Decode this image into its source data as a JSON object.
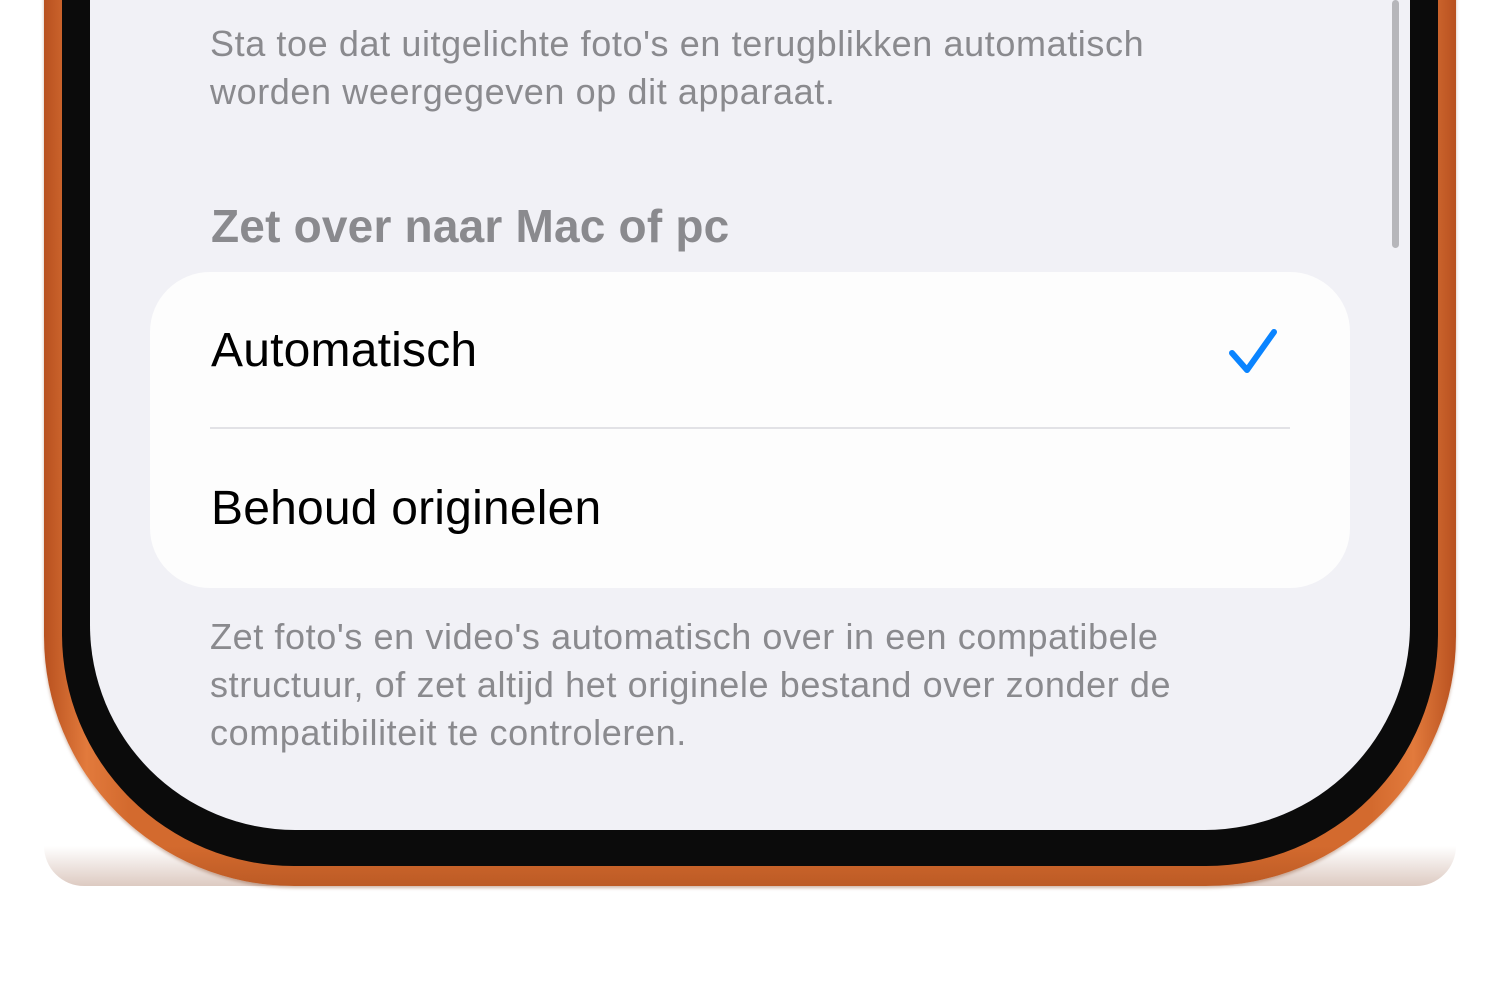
{
  "settings": {
    "top_footer": {
      "line1": "Sta toe dat uitgelichte foto's en terugblikken automatisch",
      "line2": "worden weergegeven op dit apparaat."
    },
    "section_header": "Zet over naar Mac of pc",
    "options": [
      {
        "label": "Automatisch",
        "selected": true
      },
      {
        "label": "Behoud originelen",
        "selected": false
      }
    ],
    "bottom_footer": {
      "line1": "Zet foto's en video's automatisch over in een compatibele",
      "line2": "structuur, of zet altijd het originele bestand over zonder de",
      "line3": "compatibiliteit te controleren."
    }
  },
  "icons": {
    "selected_indicator": "checkmark-icon"
  },
  "colors": {
    "accent": "#0a84ff",
    "frame": "#d36a2e",
    "background": "#f1f1f6",
    "secondary_text": "#8a8a8e"
  }
}
